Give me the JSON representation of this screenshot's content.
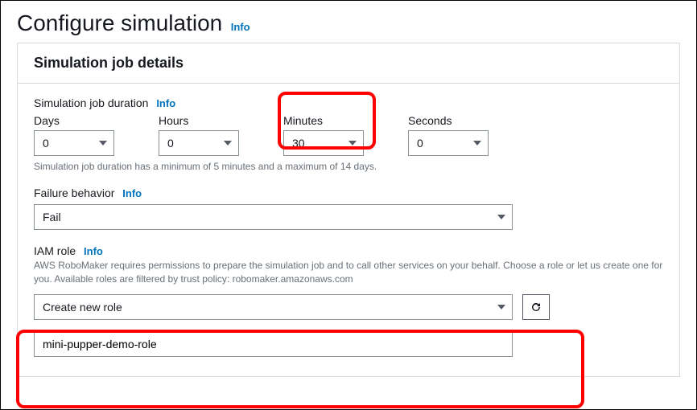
{
  "page": {
    "title": "Configure simulation",
    "info": "Info"
  },
  "panel": {
    "title": "Simulation job details"
  },
  "duration": {
    "label": "Simulation job duration",
    "info": "Info",
    "days_label": "Days",
    "hours_label": "Hours",
    "minutes_label": "Minutes",
    "seconds_label": "Seconds",
    "days": "0",
    "hours": "0",
    "minutes": "30",
    "seconds": "0",
    "hint": "Simulation job duration has a minimum of 5 minutes and a maximum of 14 days."
  },
  "failure": {
    "label": "Failure behavior",
    "info": "Info",
    "value": "Fail"
  },
  "iam": {
    "label": "IAM role",
    "info": "Info",
    "desc": "AWS RoboMaker requires permissions to prepare the simulation job and to call other services on your behalf. Choose a role or let us create one for you. Available roles are filtered by trust policy: robomaker.amazonaws.com",
    "role_select": "Create new role",
    "role_name": "mini-pupper-demo-role"
  }
}
